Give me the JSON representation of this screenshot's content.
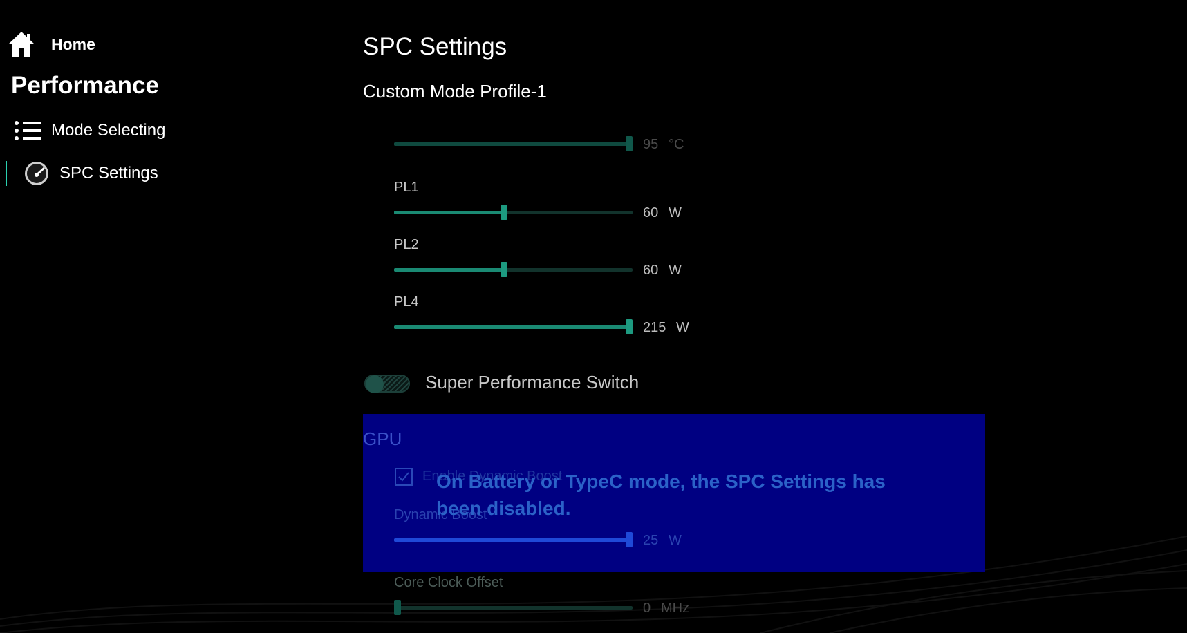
{
  "sidebar": {
    "home_label": "Home",
    "section_title": "Performance",
    "items": [
      {
        "label": "Mode Selecting",
        "icon": "list-icon"
      },
      {
        "label": "SPC Settings",
        "icon": "gauge-icon",
        "selected": true
      }
    ]
  },
  "main": {
    "title": "SPC Settings",
    "profile": "Custom Mode Profile-1",
    "sliders": [
      {
        "label": "",
        "value": "95",
        "unit": "°C",
        "level": 1.0
      },
      {
        "label": "PL1",
        "value": "60",
        "unit": "W",
        "level": 0.46
      },
      {
        "label": "PL2",
        "value": "60",
        "unit": "W",
        "level": 0.46
      },
      {
        "label": "PL4",
        "value": "215",
        "unit": "W",
        "level": 1.0
      }
    ],
    "switch_label": "Super Performance Switch",
    "switch_on": false,
    "gpu": {
      "title": "GPU",
      "checkbox_label": "Enable Dynamic Boost",
      "checkbox_checked": true,
      "sliders": [
        {
          "label": "Dynamic Boost",
          "value": "25",
          "unit": "W",
          "level": 1.0
        },
        {
          "label": "Core Clock Offset",
          "value": "0",
          "unit": "MHz",
          "level": 0.0
        }
      ]
    },
    "disabled_message": "On Battery  or TypeC mode, the SPC Settings has been disabled."
  },
  "colors": {
    "accent": "#1d9a80",
    "overlay": "#00008c",
    "overlay_text": "#2b62c8"
  }
}
